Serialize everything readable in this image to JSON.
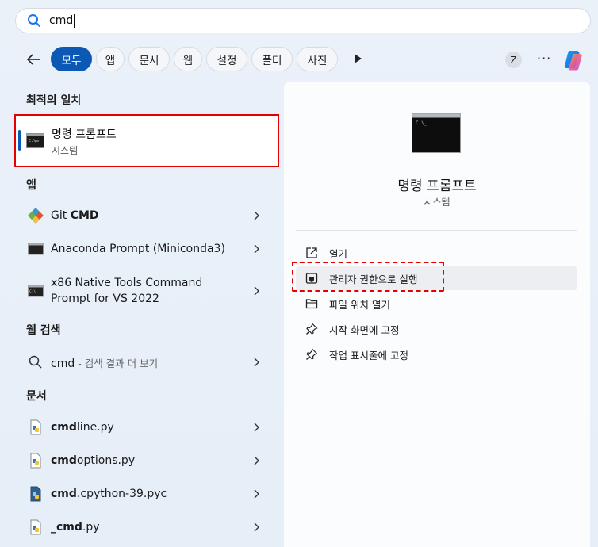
{
  "search": {
    "query": "cmd"
  },
  "filters": {
    "tabs": [
      "모두",
      "앱",
      "문서",
      "웹",
      "설정",
      "폴더",
      "사진"
    ],
    "active_index": 0,
    "avatar_letter": "Z",
    "more_label": "···"
  },
  "best_match": {
    "header": "최적의 일치",
    "title": "명령 프롬프트",
    "subtitle": "시스템"
  },
  "apps": {
    "header": "앱",
    "items": [
      {
        "prefix": "Git ",
        "match": "CMD",
        "suffix": "",
        "icon": "git-icon"
      },
      {
        "prefix": "Anaconda Prompt (Miniconda3)",
        "match": "",
        "suffix": "",
        "icon": "terminal-icon"
      },
      {
        "line1": "x86 Native Tools Command",
        "line2": "Prompt for VS 2022",
        "icon": "vs-terminal-icon"
      }
    ]
  },
  "web": {
    "header": "웹 검색",
    "query": "cmd",
    "suffix": " - 검색 결과 더 보기"
  },
  "documents": {
    "header": "문서",
    "items": [
      {
        "match": "cmd",
        "rest": "line.py"
      },
      {
        "match": "cmd",
        "rest": "options.py"
      },
      {
        "match": "cmd",
        "rest": ".cpython-39.pyc"
      },
      {
        "match": "_cmd",
        "rest": ".py"
      }
    ]
  },
  "detail": {
    "title": "명령 프롬프트",
    "subtitle": "시스템",
    "actions": [
      {
        "label": "열기",
        "icon": "open-external-icon"
      },
      {
        "label": "관리자 권한으로 실행",
        "icon": "shield-icon"
      },
      {
        "label": "파일 위치 열기",
        "icon": "folder-icon"
      },
      {
        "label": "시작 화면에 고정",
        "icon": "pin-icon"
      },
      {
        "label": "작업 표시줄에 고정",
        "icon": "pin-icon"
      }
    ]
  },
  "colors": {
    "accent": "#0c59b5",
    "highlight_border": "#e40000"
  }
}
